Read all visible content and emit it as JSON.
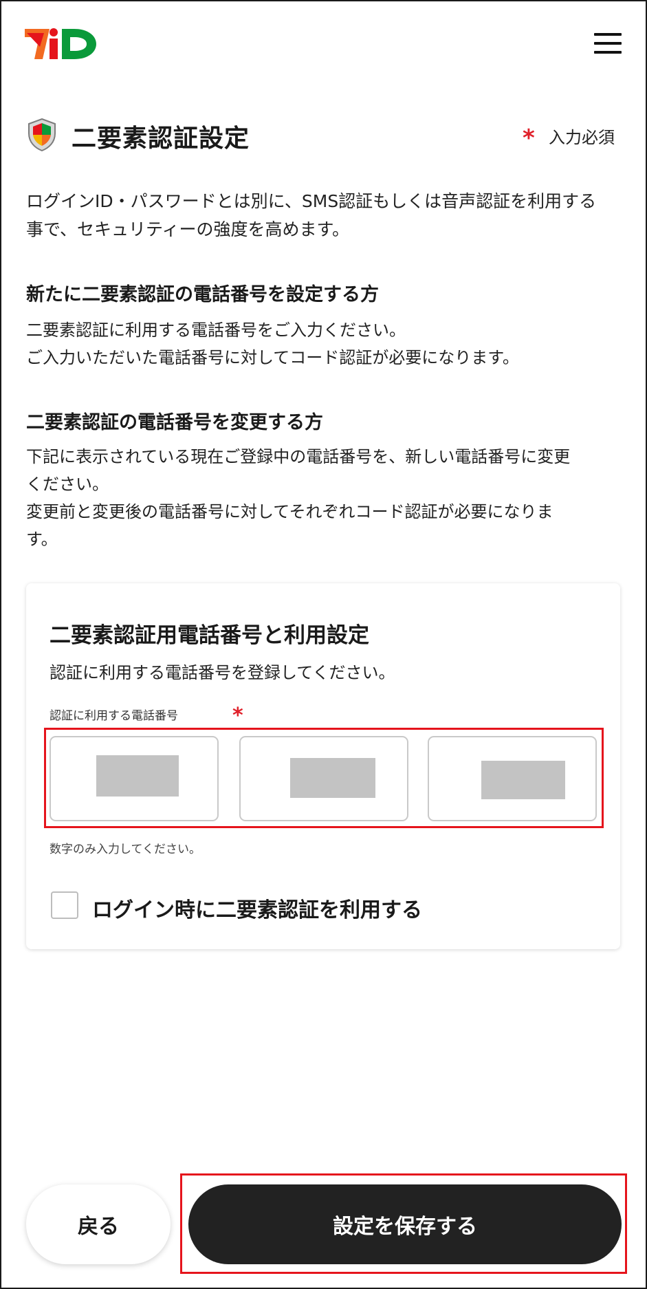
{
  "header": {
    "logo_text": "7iD",
    "logo_icon": "seven-id-logo",
    "menu_icon": "hamburger-menu-icon"
  },
  "page": {
    "title": "二要素認証設定",
    "title_icon": "shield-icon",
    "required_mark": "*",
    "required_label": "入力必須",
    "intro_line1": "ログインID・パスワードとは別に、SMS認証もしくは音声認証を利用する",
    "intro_line2": "事で、セキュリティーの強度を高めます。"
  },
  "section_new": {
    "title": "新たに二要素認証の電話番号を設定する方",
    "line1": "二要素認証に利用する電話番号をご入力ください。",
    "line2": "ご入力いただいた電話番号に対してコード認証が必要になります。"
  },
  "section_change": {
    "title": "二要素認証の電話番号を変更する方",
    "line1": "下記に表示されている現在ご登録中の電話番号を、新しい電話番号に変更",
    "line2": "ください。",
    "line3": "変更前と変更後の電話番号に対してそれぞれコード認証が必要になりま",
    "line4": "す。"
  },
  "card": {
    "title": "二要素認証用電話番号と利用設定",
    "subtitle": "認証に利用する電話番号を登録してください。",
    "field_label": "認証に利用する電話番号",
    "field_required": "*",
    "hint": "数字のみ入力してください。",
    "checkbox_label": "ログイン時に二要素認証を利用する",
    "checkbox_checked": false
  },
  "footer": {
    "back_label": "戻る",
    "save_label": "設定を保存する"
  },
  "colors": {
    "accent_red": "#e0202a",
    "logo_orange": "#f26a21",
    "logo_red": "#e5141c",
    "logo_green": "#0a9a3a",
    "dark_button": "#222222",
    "highlight_red": "#e5141c"
  }
}
